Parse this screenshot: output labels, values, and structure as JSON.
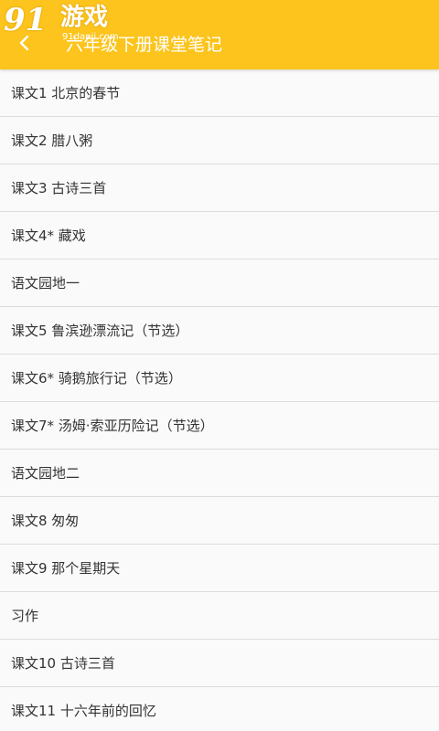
{
  "theme": {
    "toolbar_color": "#fcc41c",
    "text_color": "#333333",
    "divider_color": "#dcdcdc"
  },
  "watermark": {
    "logo": "91",
    "text": "游戏",
    "url": "91danji.com"
  },
  "toolbar": {
    "back_icon": "chevron-left-icon",
    "title": "六年级下册课堂笔记"
  },
  "lessons": [
    "课文1 北京的春节",
    "课文2 腊八粥",
    "课文3 古诗三首",
    "课文4* 藏戏",
    "语文园地一",
    "课文5 鲁滨逊漂流记（节选）",
    "课文6* 骑鹅旅行记（节选）",
    "课文7* 汤姆·索亚历险记（节选）",
    "语文园地二",
    "课文8 匆匆",
    "课文9 那个星期天",
    "习作",
    "课文10 古诗三首",
    "课文11 十六年前的回忆"
  ]
}
